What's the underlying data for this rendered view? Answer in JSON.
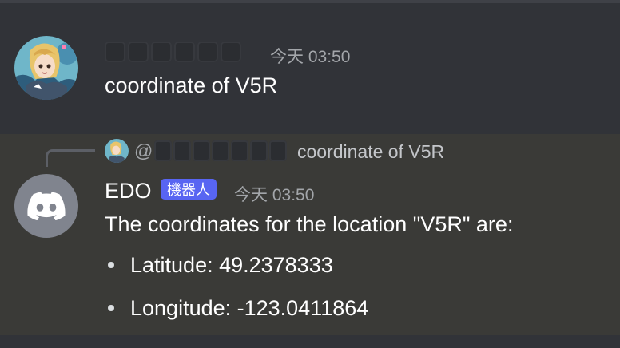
{
  "message1": {
    "author_redacted": true,
    "timestamp": "今天 03:50",
    "content": "coordinate of V5R"
  },
  "message2": {
    "reply": {
      "at": "@",
      "author_redacted": true,
      "content": "coordinate of V5R"
    },
    "author": "EDO",
    "bot_tag": "機器人",
    "timestamp": "今天 03:50",
    "content": "The coordinates for the location \"V5R\" are:",
    "bullets": [
      "Latitude: 49.2378333",
      "Longitude: -123.0411864"
    ]
  },
  "colors": {
    "background": "#313338",
    "highlight_row": "#3a3a37",
    "bot_tag": "#5865f2",
    "timestamp": "#a3a6aa",
    "discord_avatar": "#80848e"
  },
  "icons": {
    "bot_avatar": "discord-logo-icon",
    "user_avatar": "anime-avatar-image"
  }
}
